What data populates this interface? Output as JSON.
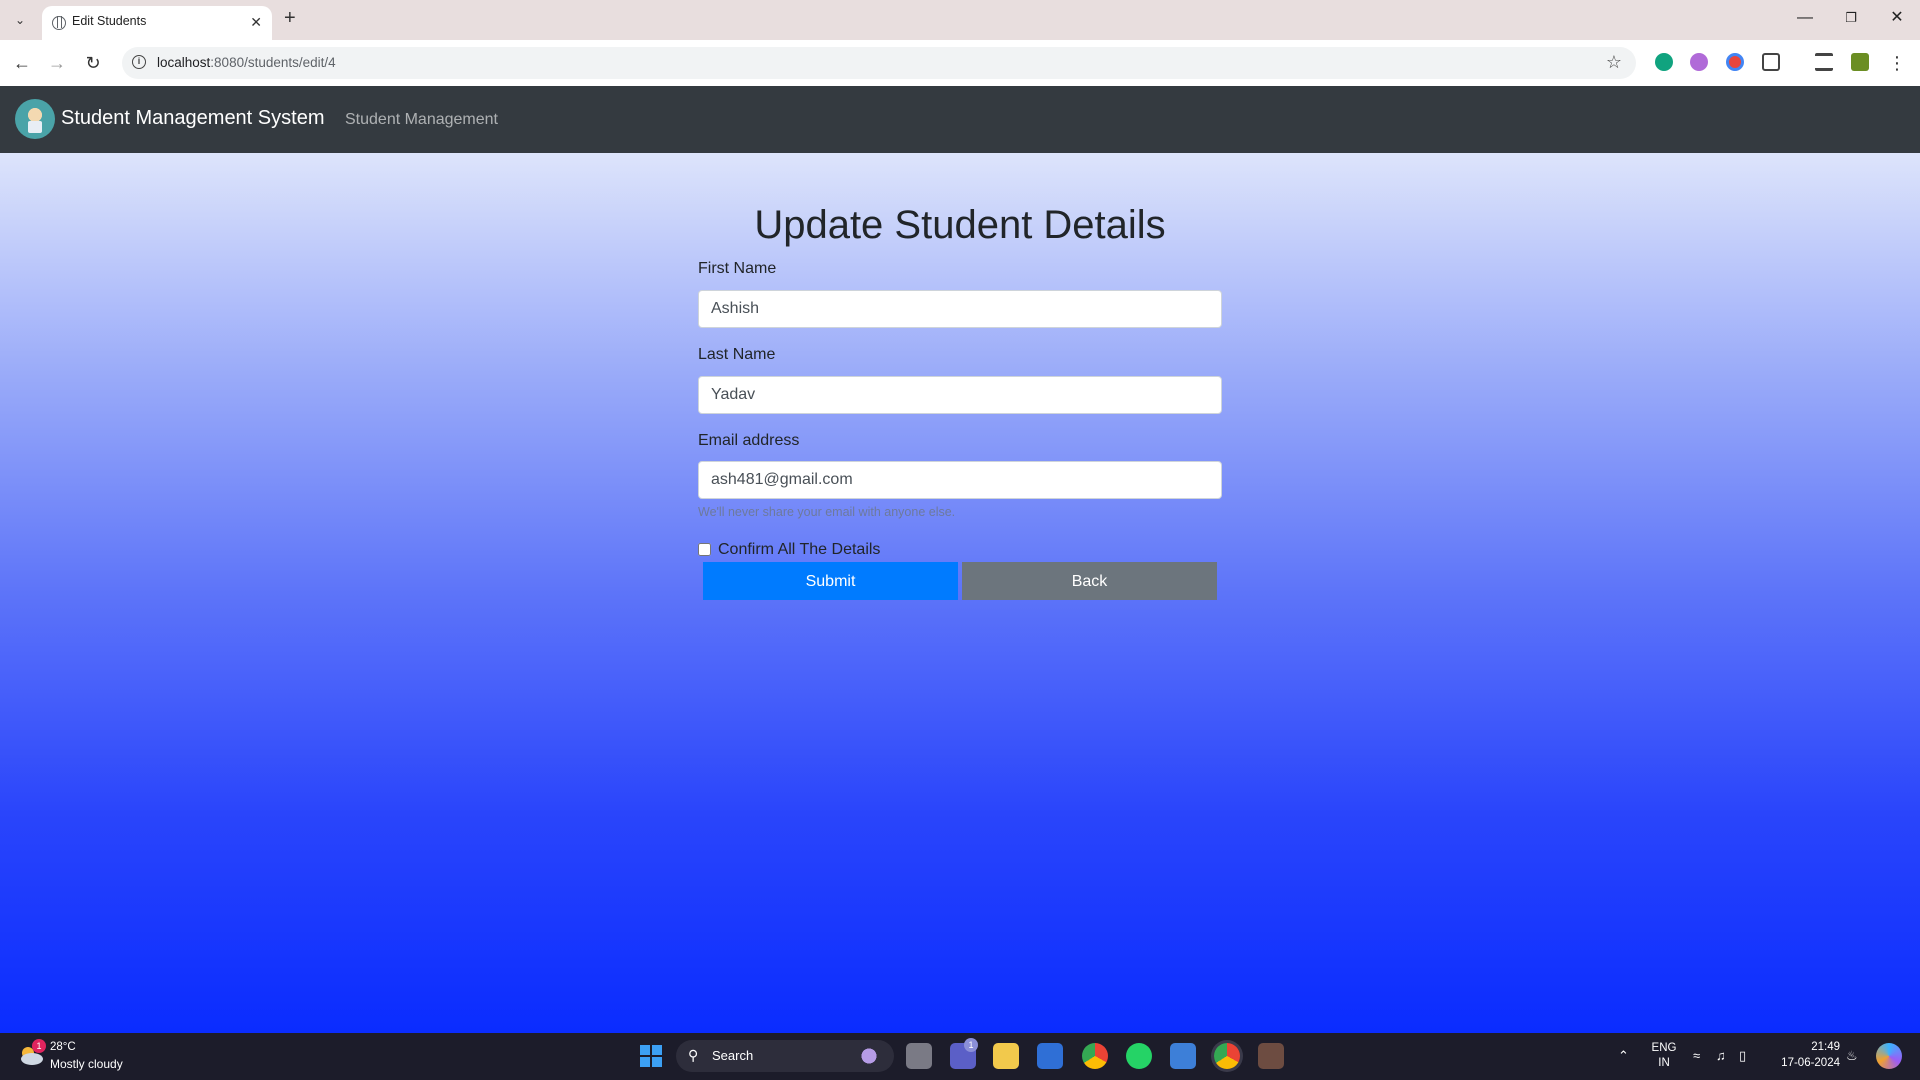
{
  "browser": {
    "tab_title": "Edit Students",
    "url_host": "localhost",
    "url_rest": ":8080/students/edit/4"
  },
  "navbar": {
    "brand": "Student Management System",
    "link": "Student Management"
  },
  "form": {
    "title": "Update Student Details",
    "first_name_label": "First Name",
    "first_name_value": "Ashish",
    "last_name_label": "Last Name",
    "last_name_value": "Yadav",
    "email_label": "Email address",
    "email_value": "ash481@gmail.com",
    "email_help": "We'll never share your email with anyone else.",
    "confirm_label": "Confirm All The Details",
    "confirm_checked": false,
    "submit_label": "Submit",
    "back_label": "Back"
  },
  "colors": {
    "navbar": "#343a40",
    "primary": "#007bff",
    "secondary": "#6c757d",
    "gradient_top": "#dde4fb",
    "gradient_bottom": "#0a2cff"
  },
  "taskbar": {
    "weather_badge": "1",
    "temperature": "28°C",
    "weather": "Mostly cloudy",
    "search_label": "Search",
    "teams_badge": "1",
    "lang_top": "ENG",
    "lang_bottom": "IN",
    "time": "21:49",
    "date": "17-06-2024"
  },
  "icons": [
    "tab-list-icon",
    "globe-favicon-icon",
    "close-icon",
    "plus-icon",
    "minimize-icon",
    "restore-icon",
    "close-window-icon",
    "back-icon",
    "forward-icon",
    "reload-icon",
    "site-info-icon",
    "star-icon",
    "extension-icons",
    "windows-start-icon",
    "search-icon",
    "wifi-icon",
    "volume-icon",
    "battery-icon",
    "bell-icon"
  ]
}
